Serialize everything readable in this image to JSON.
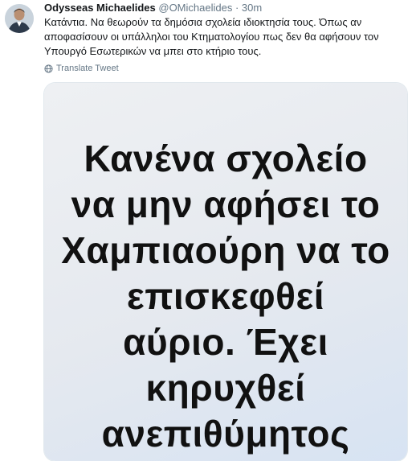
{
  "tweet": {
    "display_name": "Odysseas Michaelides",
    "screen_name": "@OMichaelides",
    "separator": "·",
    "time": "30m",
    "text": "Κατάντια. Να θεωρούν τα δημόσια σχολεία ιδιοκτησία τους. Όπως αν αποφασίσουν οι υπάλληλοι του Κτηματολογίου πως δεν θα αφήσουν τον Υπουργό Εσωτερικών να μπει στο κτήριο τους.",
    "translate_label": "Translate Tweet",
    "translate_icon": "globe-icon",
    "avatar_icon": "user-avatar"
  },
  "media": {
    "lines": [
      "Κανένα σχολείο",
      "να μην αφήσει το",
      "Χαμπιαούρη να το",
      "επισκεφθεί",
      "αύριο. Έχει",
      "κηρυχθεί",
      "ανεπιθύμητος"
    ]
  },
  "colors": {
    "text": "#14171a",
    "secondary": "#657786",
    "media_background": "#e5e9ef"
  }
}
